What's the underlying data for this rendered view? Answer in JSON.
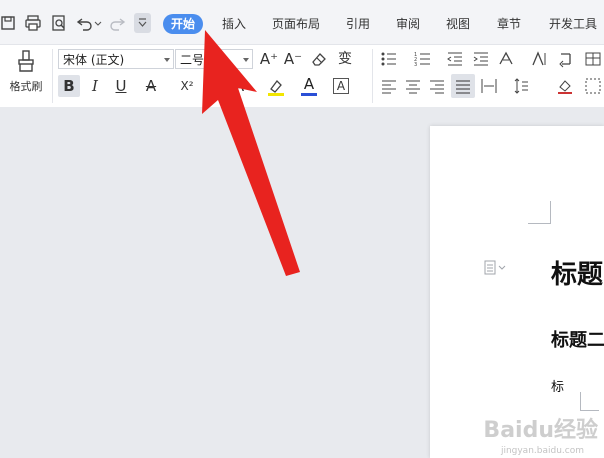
{
  "quick_access": {
    "icons": [
      "save-icon",
      "print-icon",
      "print-preview-icon",
      "undo-icon",
      "redo-icon",
      "customize-quick-access-icon"
    ]
  },
  "tabs": [
    {
      "label": "开始",
      "active": true
    },
    {
      "label": "插入",
      "active": false
    },
    {
      "label": "页面布局",
      "active": false
    },
    {
      "label": "引用",
      "active": false
    },
    {
      "label": "审阅",
      "active": false
    },
    {
      "label": "视图",
      "active": false
    },
    {
      "label": "章节",
      "active": false
    },
    {
      "label": "开发工具",
      "active": false
    }
  ],
  "ribbon": {
    "format_painter_label": "格式刷",
    "font_name": "宋体 (正文)",
    "font_size": "二号",
    "bold": "B",
    "italic": "I",
    "underline": "U",
    "strikethrough": "A",
    "superscript": "X²",
    "font_color_letter": "A",
    "char_shading": "A",
    "grow_font": "A⁺",
    "shrink_font": "A⁻"
  },
  "document": {
    "heading1": "标题",
    "heading2": "标题二",
    "body_char": "标"
  },
  "watermark": {
    "brand": "Baidu经验",
    "url": "jingyan.baidu.com"
  },
  "colors": {
    "active_tab": "#4a8dee",
    "arrow": "#e8231f",
    "highlight_yellow": "#f2e600",
    "font_color_blue": "#2a4fd6"
  }
}
